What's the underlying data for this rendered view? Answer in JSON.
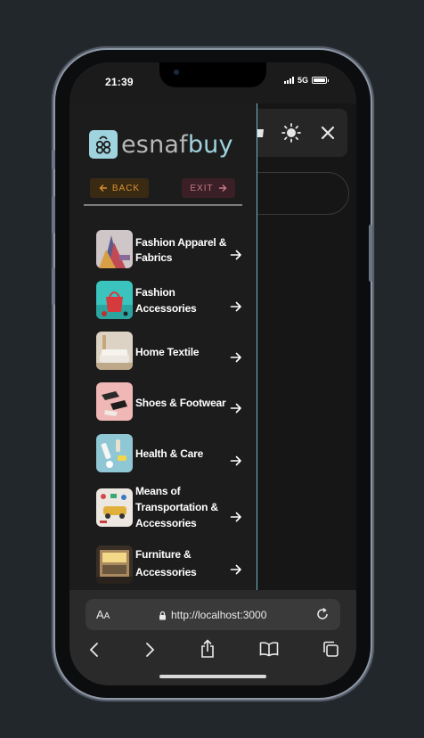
{
  "status": {
    "time": "21:39",
    "network": "5G",
    "battery_level": 1.0
  },
  "logo": {
    "brand_part1": "esnaf",
    "brand_part2": "buy"
  },
  "nav": {
    "back_label": "BACK",
    "exit_label": "EXIT"
  },
  "categories": [
    {
      "line1": "Fashion Apparel &",
      "line2": "Fabrics",
      "line3": ""
    },
    {
      "line1": "Fashion",
      "line2": "Accessories",
      "line3": ""
    },
    {
      "line1": "Home Textile",
      "line2": "",
      "line3": ""
    },
    {
      "line1": "Shoes & Footwear",
      "line2": "",
      "line3": ""
    },
    {
      "line1": "Health & Care",
      "line2": "",
      "line3": ""
    },
    {
      "line1": "Means of",
      "line2": "Transportation &",
      "line3": "Accessories"
    },
    {
      "line1": "Furniture &",
      "line2": "Accessories",
      "line3": ""
    }
  ],
  "browser": {
    "text_size_label_big": "A",
    "text_size_label_small": "A",
    "url": "http://localhost:3000"
  },
  "colors": {
    "accent": "#9fd3de",
    "drawer_border": "#6fb7cf",
    "back": "#d9902f",
    "exit": "#c77a86"
  }
}
